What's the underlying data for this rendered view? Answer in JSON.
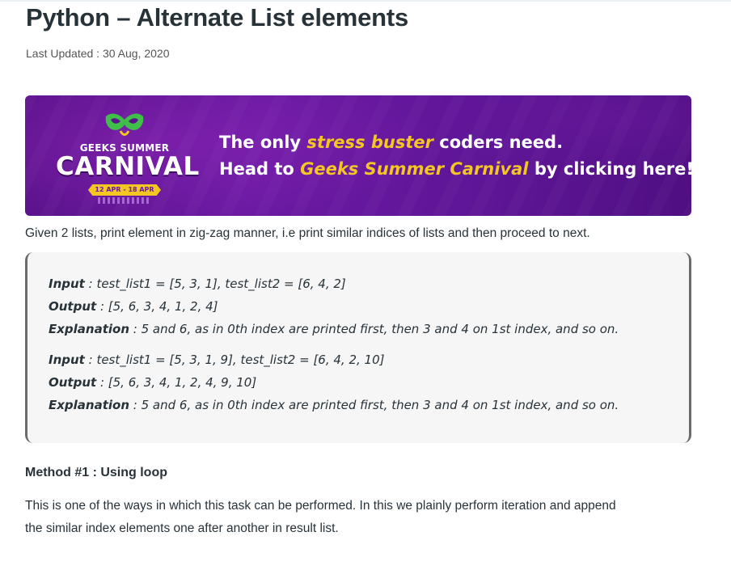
{
  "article": {
    "title": "Python – Alternate List elements",
    "last_updated": "Last Updated : 30 Aug, 2020"
  },
  "banner": {
    "logo_top": "GEEKS SUMMER",
    "logo_main": "CARNIVAL",
    "logo_dates": "12 APR - 18 APR",
    "line1": {
      "pre": "The only ",
      "highlight": "stress buster",
      "post": " coders need."
    },
    "line2": {
      "pre": "Head to ",
      "highlight": "Geeks Summer Carnival",
      "post": " by clicking here!"
    },
    "colors": {
      "background": "#6b1aa3",
      "highlight": "#f3c623"
    },
    "icons": [
      "mask-icon"
    ]
  },
  "intro": "Given 2 lists, print element in zig-zag manner, i.e print similar indices of lists and then proceed to next.",
  "examples": [
    {
      "input_label": "Input",
      "input_value": " : test_list1 = [5, 3, 1], test_list2 = [6, 4, 2]",
      "output_label": "Output",
      "output_value": " : [5, 6, 3, 4, 1, 2, 4]",
      "explanation_label": "Explanation",
      "explanation_value": " : 5 and 6, as in 0th index are printed first, then 3 and 4 on 1st index, and so on."
    },
    {
      "input_label": "Input",
      "input_value": " : test_list1 = [5, 3, 1, 9], test_list2 = [6, 4, 2, 10]",
      "output_label": "Output",
      "output_value": " : [5, 6, 3, 4, 1, 2, 4, 9, 10]",
      "explanation_label": "Explanation",
      "explanation_value": " : 5 and 6, as in 0th index are printed first, then 3 and 4 on 1st index, and so on."
    }
  ],
  "method": {
    "heading": "Method #1 : Using loop",
    "description_line1": "This is one of the ways in which this task can be performed. In this we plainly perform iteration and append",
    "description_line2": "the similar index elements one after another in result list."
  }
}
